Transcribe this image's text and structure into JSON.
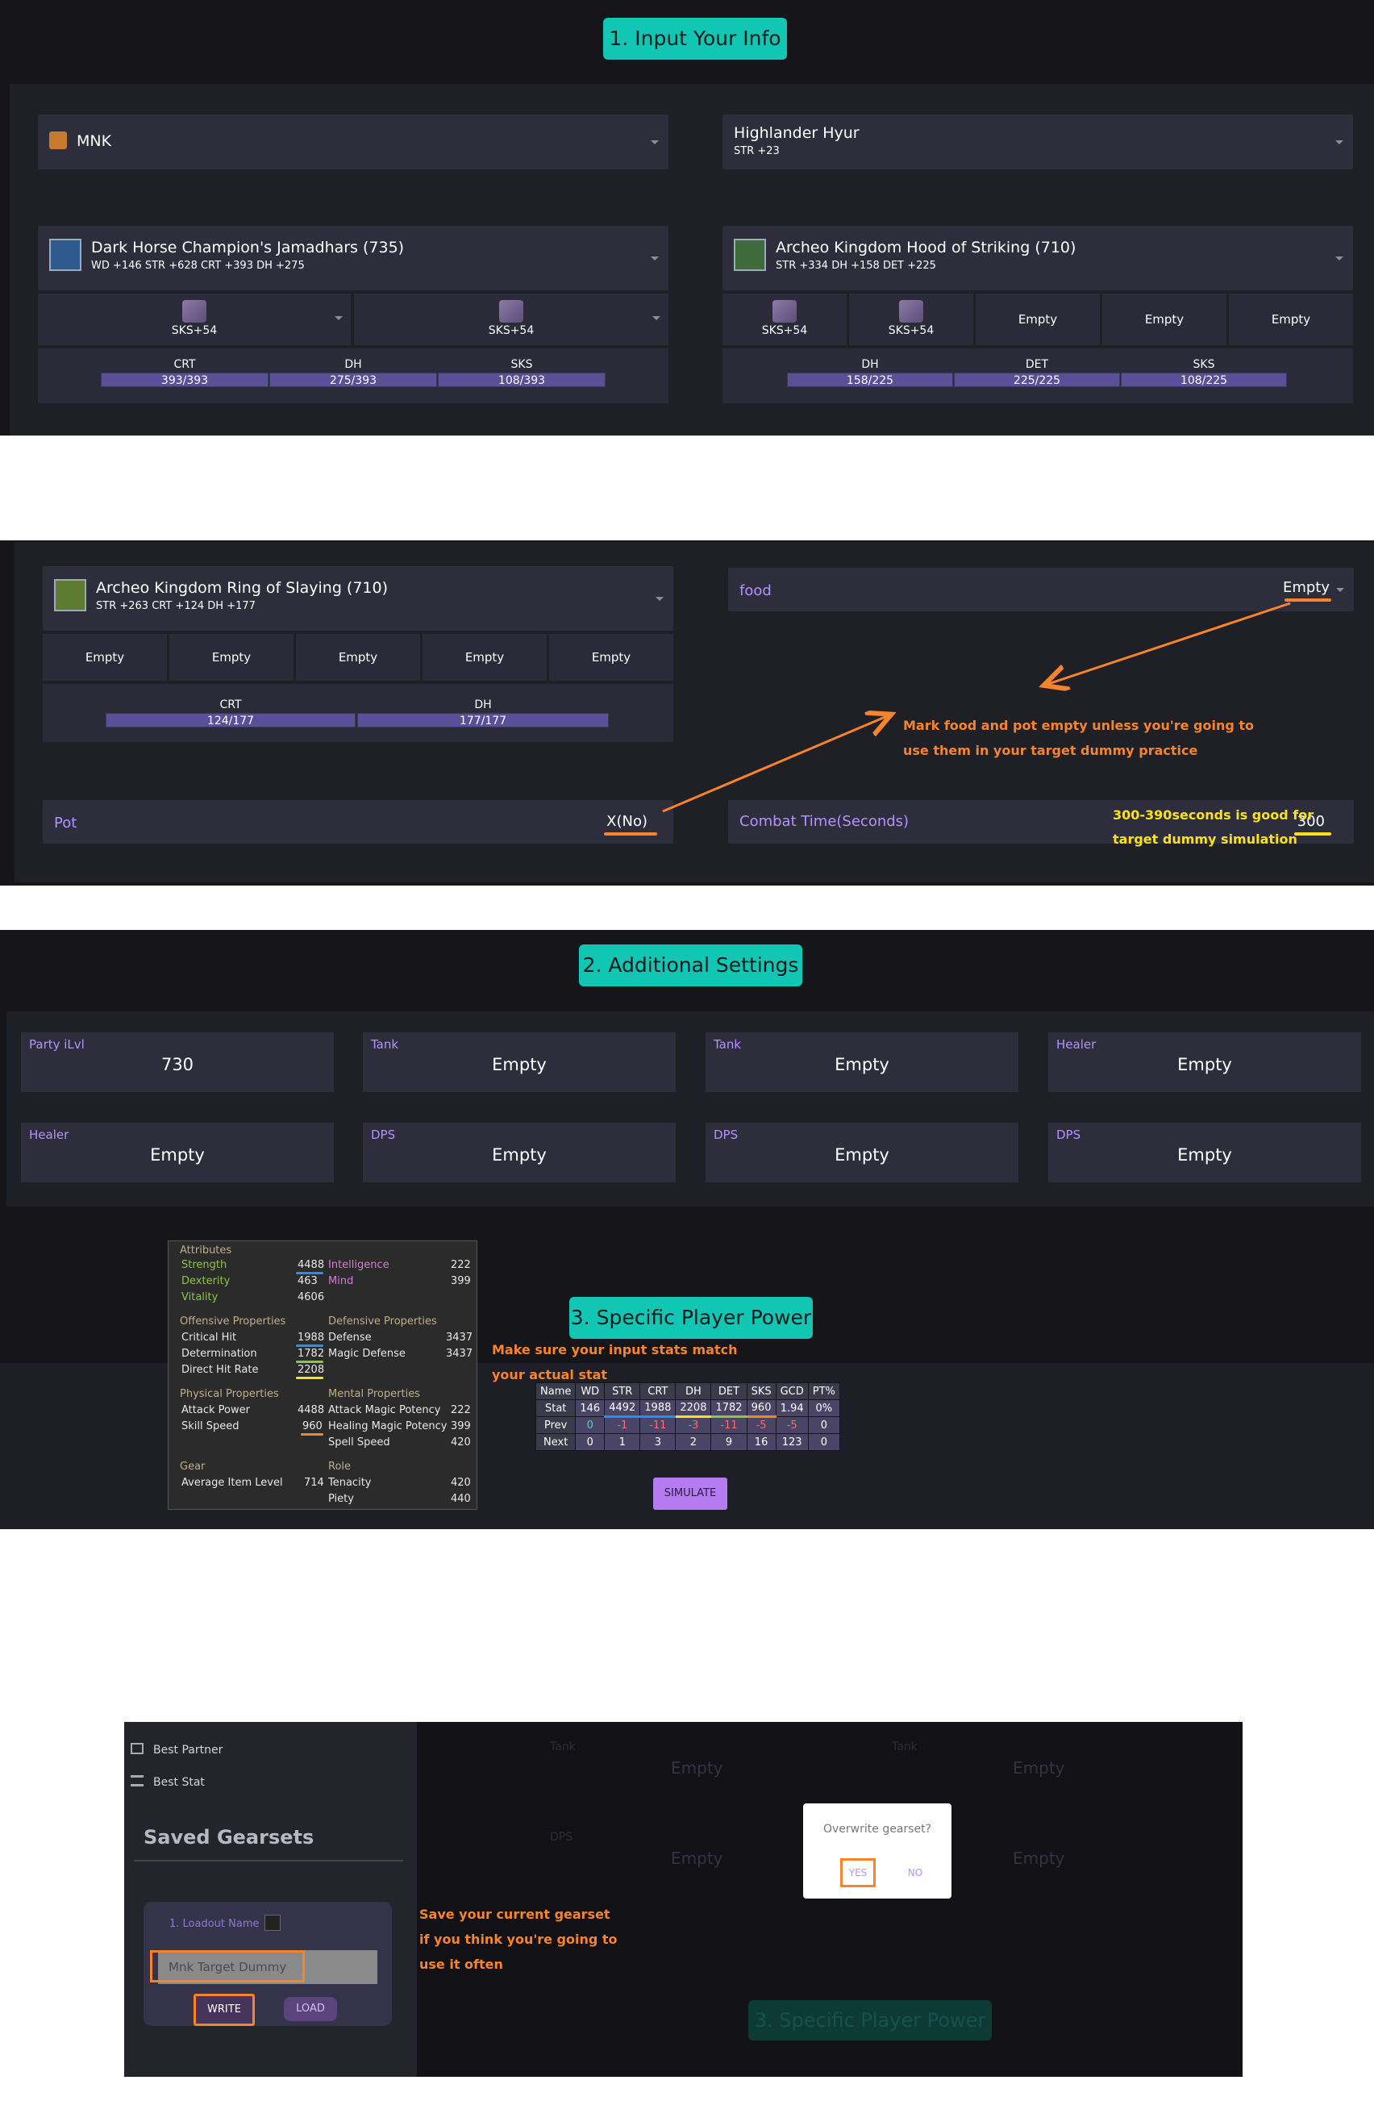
{
  "section1": {
    "title": "1. Input Your Info",
    "job": "MNK",
    "race": {
      "name": "Highlander Hyur",
      "bonus": "STR +23"
    },
    "weapon": {
      "name": "Dark Horse Champion's Jamadhars (735)",
      "stats": "WD +146 STR +628 CRT +393 DH +275",
      "melds": [
        "SKS+54",
        "SKS+54"
      ],
      "caps": [
        {
          "stat": "CRT",
          "value": "393/393"
        },
        {
          "stat": "DH",
          "value": "275/393"
        },
        {
          "stat": "SKS",
          "value": "108/393"
        }
      ]
    },
    "head": {
      "name": "Archeo Kingdom Hood of Striking (710)",
      "stats": "STR +334 DH +158 DET +225",
      "melds": [
        "SKS+54",
        "SKS+54",
        "Empty",
        "Empty",
        "Empty"
      ],
      "caps": [
        {
          "stat": "DH",
          "value": "158/225"
        },
        {
          "stat": "DET",
          "value": "225/225"
        },
        {
          "stat": "SKS",
          "value": "108/225"
        }
      ]
    },
    "ring": {
      "name": "Archeo Kingdom Ring of Slaying (710)",
      "stats": "STR +263 CRT +124 DH +177",
      "melds": [
        "Empty",
        "Empty",
        "Empty",
        "Empty",
        "Empty"
      ],
      "caps": [
        {
          "stat": "CRT",
          "value": "124/177"
        },
        {
          "stat": "DH",
          "value": "177/177"
        }
      ]
    },
    "food": {
      "label": "food",
      "value": "Empty"
    },
    "pot": {
      "label": "Pot",
      "value": "X(No)"
    },
    "combat": {
      "label": "Combat Time(Seconds)",
      "value": "300"
    },
    "note_food_pot": [
      "Mark food and pot empty unless you're going to",
      "use them in your target dummy practice"
    ],
    "note_combat": [
      "300-390seconds is good for",
      "target dummy simulation"
    ]
  },
  "section2": {
    "title": "2. Additional Settings",
    "party": [
      {
        "role": "Party iLvl",
        "value": "730"
      },
      {
        "role": "Tank",
        "value": "Empty"
      },
      {
        "role": "Tank",
        "value": "Empty"
      },
      {
        "role": "Healer",
        "value": "Empty"
      },
      {
        "role": "Healer",
        "value": "Empty"
      },
      {
        "role": "DPS",
        "value": "Empty"
      },
      {
        "role": "DPS",
        "value": "Empty"
      },
      {
        "role": "DPS",
        "value": "Empty"
      }
    ]
  },
  "section3": {
    "title": "3. Specific Player Power",
    "note": [
      "Make sure your input stats match",
      "your actual stat"
    ],
    "table": {
      "headers": [
        "Name",
        "WD",
        "STR",
        "CRT",
        "DH",
        "DET",
        "SKS",
        "GCD",
        "PT%"
      ],
      "rows": [
        [
          "Stat",
          "146",
          "4492",
          "1988",
          "2208",
          "1782",
          "960",
          "1.94",
          "0%"
        ],
        [
          "Prev",
          "0",
          "-1",
          "-11",
          "-3",
          "-11",
          "-5",
          "-5",
          "0"
        ],
        [
          "Next",
          "0",
          "1",
          "3",
          "2",
          "9",
          "16",
          "123",
          "0"
        ]
      ]
    },
    "simulate": "SIMULATE",
    "attributes": {
      "title": "Attributes",
      "left": [
        [
          "Strength",
          "4488"
        ],
        [
          "Dexterity",
          "463"
        ],
        [
          "Vitality",
          "4606"
        ]
      ],
      "right": [
        [
          "Intelligence",
          "222"
        ],
        [
          "Mind",
          "399"
        ]
      ],
      "offensive_title": "Offensive Properties",
      "defensive_title": "Defensive Properties",
      "offensive": [
        [
          "Critical Hit",
          "1988"
        ],
        [
          "Determination",
          "1782"
        ],
        [
          "Direct Hit Rate",
          "2208"
        ]
      ],
      "defensive": [
        [
          "Defense",
          "3437"
        ],
        [
          "Magic Defense",
          "3437"
        ]
      ],
      "physical_title": "Physical Properties",
      "mental_title": "Mental Properties",
      "physical": [
        [
          "Attack Power",
          "4488"
        ],
        [
          "Skill Speed",
          "960"
        ]
      ],
      "mental": [
        [
          "Attack Magic Potency",
          "222"
        ],
        [
          "Healing Magic Potency",
          "399"
        ],
        [
          "Spell Speed",
          "420"
        ]
      ],
      "gear_title": "Gear",
      "role_title": "Role",
      "gear": [
        [
          "Average Item Level",
          "714"
        ]
      ],
      "role": [
        [
          "Tenacity",
          "420"
        ],
        [
          "Piety",
          "440"
        ]
      ]
    }
  },
  "section4": {
    "sidebar": [
      "Best Partner",
      "Best Stat"
    ],
    "saved_title": "Saved Gearsets",
    "loadout_label": "1. Loadout Name",
    "loadout_value": "Mnk Target Dummy",
    "write": "WRITE",
    "load": "LOAD",
    "dialog": {
      "question": "Overwrite gearset?",
      "yes": "YES",
      "no": "NO"
    },
    "note": [
      "Save your current gearset",
      "if you think you're going to",
      "use it often"
    ],
    "bg": {
      "tank1": "Tank",
      "tank2": "Tank",
      "dps": "DPS",
      "empty": "Empty",
      "header": "3. Specific Player Power"
    }
  }
}
